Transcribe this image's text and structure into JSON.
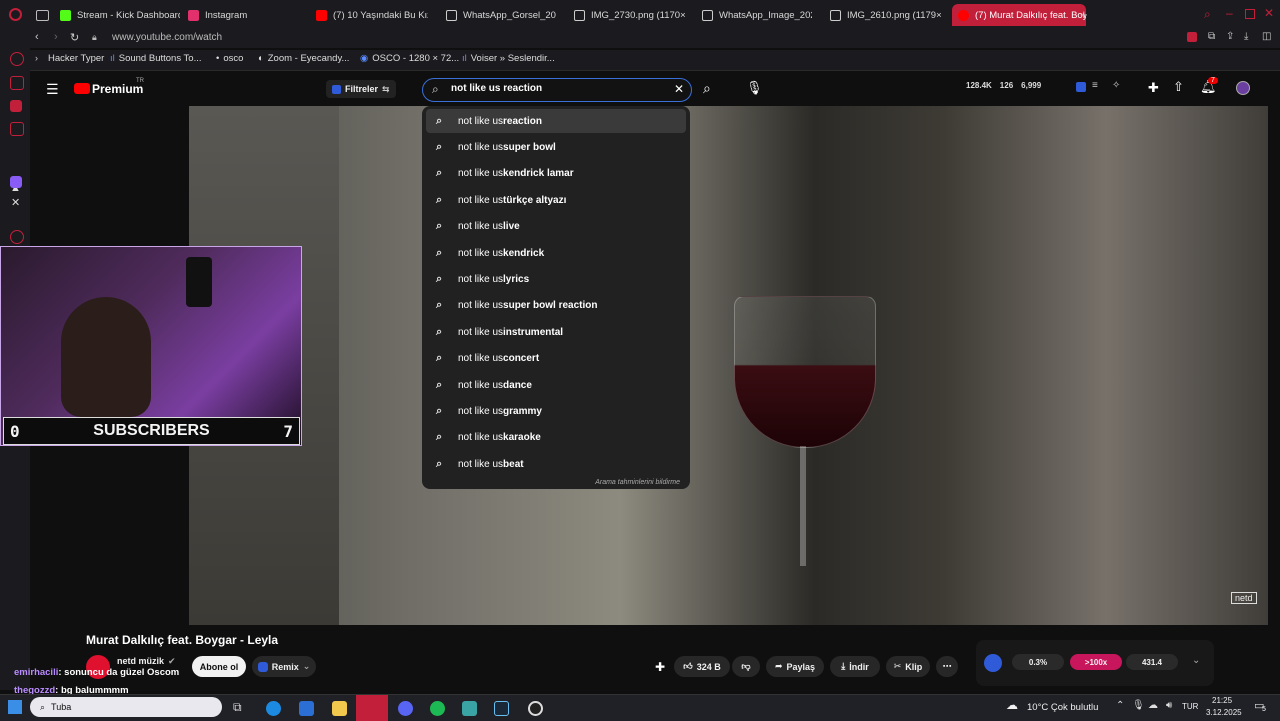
{
  "tabs": [
    {
      "label": "Stream - Kick Dashboard",
      "color": "#53fc18"
    },
    {
      "label": "Instagram",
      "color": "#e1306c"
    },
    {
      "label": "(7) 10 Yaşındaki Bu Kızın",
      "color": "#ff0000"
    },
    {
      "label": "WhatsApp_Gorsel_2025-",
      "color": "#ffffff"
    },
    {
      "label": "IMG_2730.png (1170×25…",
      "color": "#ffffff"
    },
    {
      "label": "WhatsApp_Image_2025-",
      "color": "#ffffff"
    },
    {
      "label": "IMG_2610.png (1179×25…",
      "color": "#ffffff"
    },
    {
      "label": "(7) Murat Dalkılıç feat. Boy",
      "color": "#ff0000"
    }
  ],
  "address": "www.youtube.com/watch",
  "bookmarks": [
    "Hacker Typer",
    "Sound Buttons To...",
    "osco",
    "Zoom - Eyecandy...",
    "OSCO - 1280 × 72...",
    "Voiser » Seslendir..."
  ],
  "yt": {
    "logo_text": "Premium",
    "logo_sup": "TR",
    "filter_label": "Filtreler",
    "search_value": "not like us reaction",
    "stats": [
      "128.4K",
      "126",
      "6,999"
    ],
    "notif_count": "7"
  },
  "suggestions": [
    {
      "prefix": "not like us ",
      "suffix": "reaction"
    },
    {
      "prefix": "not like us ",
      "suffix": "super bowl"
    },
    {
      "prefix": "not like us ",
      "suffix": "kendrick lamar"
    },
    {
      "prefix": "not like us ",
      "suffix": "türkçe altyazı"
    },
    {
      "prefix": "not like us ",
      "suffix": "live"
    },
    {
      "prefix": "not like us ",
      "suffix": "kendrick"
    },
    {
      "prefix": "not like us ",
      "suffix": "lyrics"
    },
    {
      "prefix": "not like us ",
      "suffix": "super bowl reaction"
    },
    {
      "prefix": "not like us ",
      "suffix": "instrumental"
    },
    {
      "prefix": "not like us ",
      "suffix": "concert"
    },
    {
      "prefix": "not like us ",
      "suffix": "dance"
    },
    {
      "prefix": "not like us ",
      "suffix": "grammy"
    },
    {
      "prefix": "not like us ",
      "suffix": "karaoke"
    },
    {
      "prefix": "not like us ",
      "suffix": "beat"
    }
  ],
  "dropdown_footer": "Arama tahminlerini bildirme",
  "webcam": {
    "left_count": "0",
    "label": "SUBSCRIBERS",
    "right_count": "7"
  },
  "video": {
    "title": "Murat Dalkılıç feat. Boygar - Leyla",
    "channel": "netd müzik",
    "subscribe": "Abone ol",
    "remix": "Remix",
    "likes": "324 B",
    "share": "Paylaş",
    "download": "İndir",
    "clip": "Klip",
    "watermark": "netd"
  },
  "ext_stats": [
    "0.3%",
    ">100x",
    "431.4"
  ],
  "chat": [
    {
      "user": "emirhacili",
      "msg": ": sonuncu da güzel Oscom",
      "color": "#b98cff"
    },
    {
      "user": "thegozzd",
      "msg": ": bg balummmm",
      "color": "#b98cff"
    }
  ],
  "taskbar": {
    "weather": "10°C  Çok bulutlu",
    "lang": "TUR",
    "time": "21:25",
    "date": "3.12.2025",
    "notif": "5",
    "search_label": "Tuba"
  }
}
